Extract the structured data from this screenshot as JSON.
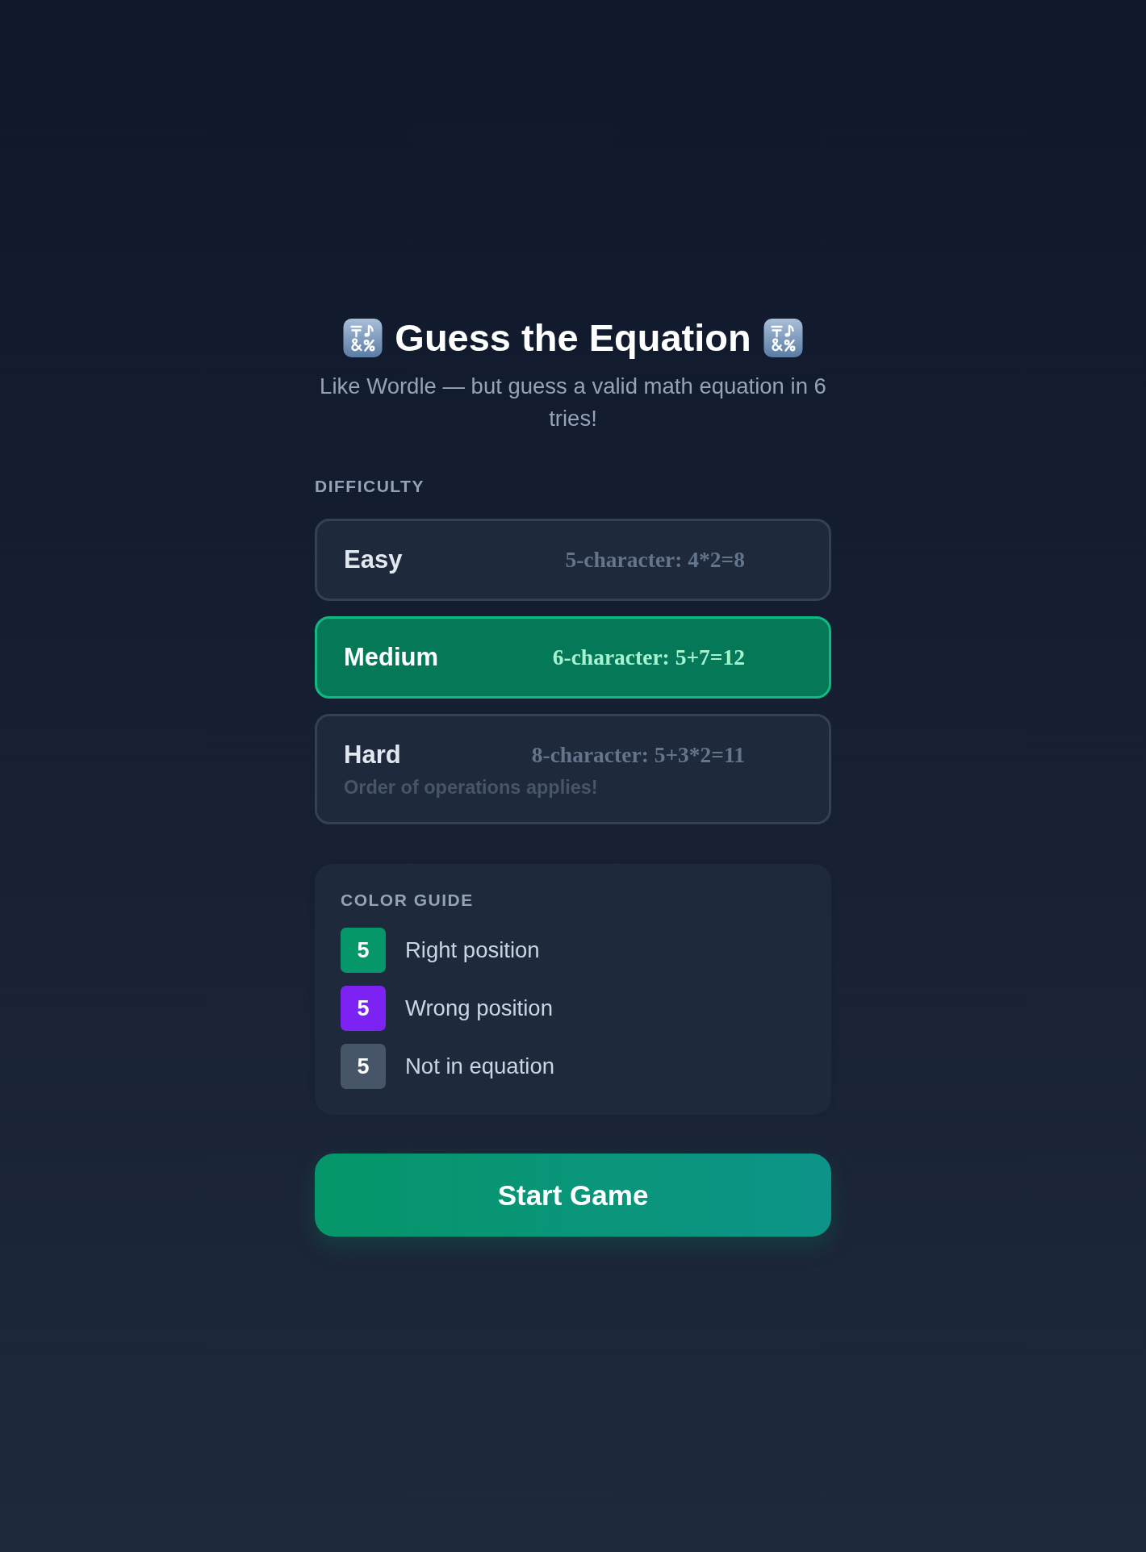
{
  "header": {
    "title": "Guess the Equation",
    "subtitle": "Like Wordle — but guess a valid math equation in 6 tries!"
  },
  "difficulty": {
    "label": "DIFFICULTY",
    "options": [
      {
        "name": "Easy",
        "description": "5-character: 4*2=8",
        "selected": false
      },
      {
        "name": "Medium",
        "description": "6-character: 5+7=12",
        "selected": true
      },
      {
        "name": "Hard",
        "description": "8-character: 5+3*2=11",
        "note": "Order of operations applies!",
        "selected": false
      }
    ]
  },
  "color_guide": {
    "title": "COLOR GUIDE",
    "items": [
      {
        "tile": "5",
        "label": "Right position",
        "color": "#059669"
      },
      {
        "tile": "5",
        "label": "Wrong position",
        "color": "#7c22f2"
      },
      {
        "tile": "5",
        "label": "Not in equation",
        "color": "#475569"
      }
    ]
  },
  "start_button": {
    "label": "Start Game"
  }
}
